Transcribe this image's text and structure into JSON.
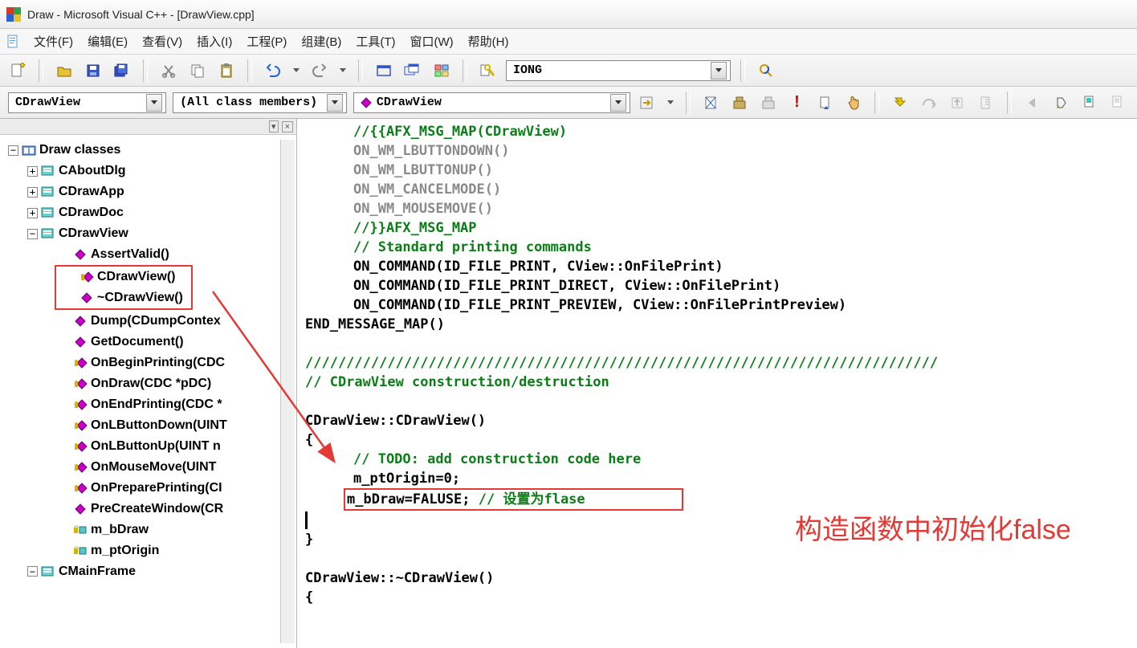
{
  "title": "Draw - Microsoft Visual C++ - [DrawView.cpp]",
  "menu": {
    "file": "文件(F)",
    "edit": "编辑(E)",
    "view": "查看(V)",
    "insert": "插入(I)",
    "project": "工程(P)",
    "build": "组建(B)",
    "tools": "工具(T)",
    "window": "窗口(W)",
    "help": "帮助(H)"
  },
  "search_box": "IONG",
  "combo_class": "CDrawView",
  "combo_members": "(All class members)",
  "combo_func": "CDrawView",
  "tree": {
    "root": "Draw classes",
    "classes": {
      "c1": "CAboutDlg",
      "c2": "CDrawApp",
      "c3": "CDrawDoc",
      "c4": "CDrawView",
      "c5": "CMainFrame"
    },
    "cdrawview_children": {
      "m0": "AssertValid()",
      "m1": "CDrawView()",
      "m2": "~CDrawView()",
      "m3": "Dump(CDumpContex",
      "m4": "GetDocument()",
      "m5": "OnBeginPrinting(CDC",
      "m6": "OnDraw(CDC *pDC)",
      "m7": "OnEndPrinting(CDC *",
      "m8": "OnLButtonDown(UINT",
      "m9": "OnLButtonUp(UINT n",
      "m10": "OnMouseMove(UINT",
      "m11": "OnPreparePrinting(CI",
      "m12": "PreCreateWindow(CR",
      "m13": "m_bDraw",
      "m14": "m_ptOrigin"
    }
  },
  "code": {
    "l0": "//{{AFX_MSG_MAP(CDrawView)",
    "l1": "ON_WM_LBUTTONDOWN()",
    "l2": "ON_WM_LBUTTONUP()",
    "l3": "ON_WM_CANCELMODE()",
    "l4": "ON_WM_MOUSEMOVE()",
    "l5": "//}}AFX_MSG_MAP",
    "l6": "// Standard printing commands",
    "l7": "ON_COMMAND(ID_FILE_PRINT, CView::OnFilePrint)",
    "l8": "ON_COMMAND(ID_FILE_PRINT_DIRECT, CView::OnFilePrint)",
    "l9": "ON_COMMAND(ID_FILE_PRINT_PREVIEW, CView::OnFilePrintPreview)",
    "l10": "END_MESSAGE_MAP()",
    "sep": "/////////////////////////////////////////////////////////////////////////////",
    "l12": "// CDrawView construction/destruction",
    "l13": "CDrawView::CDrawView()",
    "l14": "{",
    "l15": "// TODO: add construction code here",
    "l16": "m_ptOrigin=0;",
    "l17a": "m_bDraw=FALUSE; ",
    "l17b": "// 设置为flase",
    "l18": "}",
    "l19": "CDrawView::~CDrawView()",
    "l20": "{"
  },
  "annotation": "构造函数中初始化false"
}
